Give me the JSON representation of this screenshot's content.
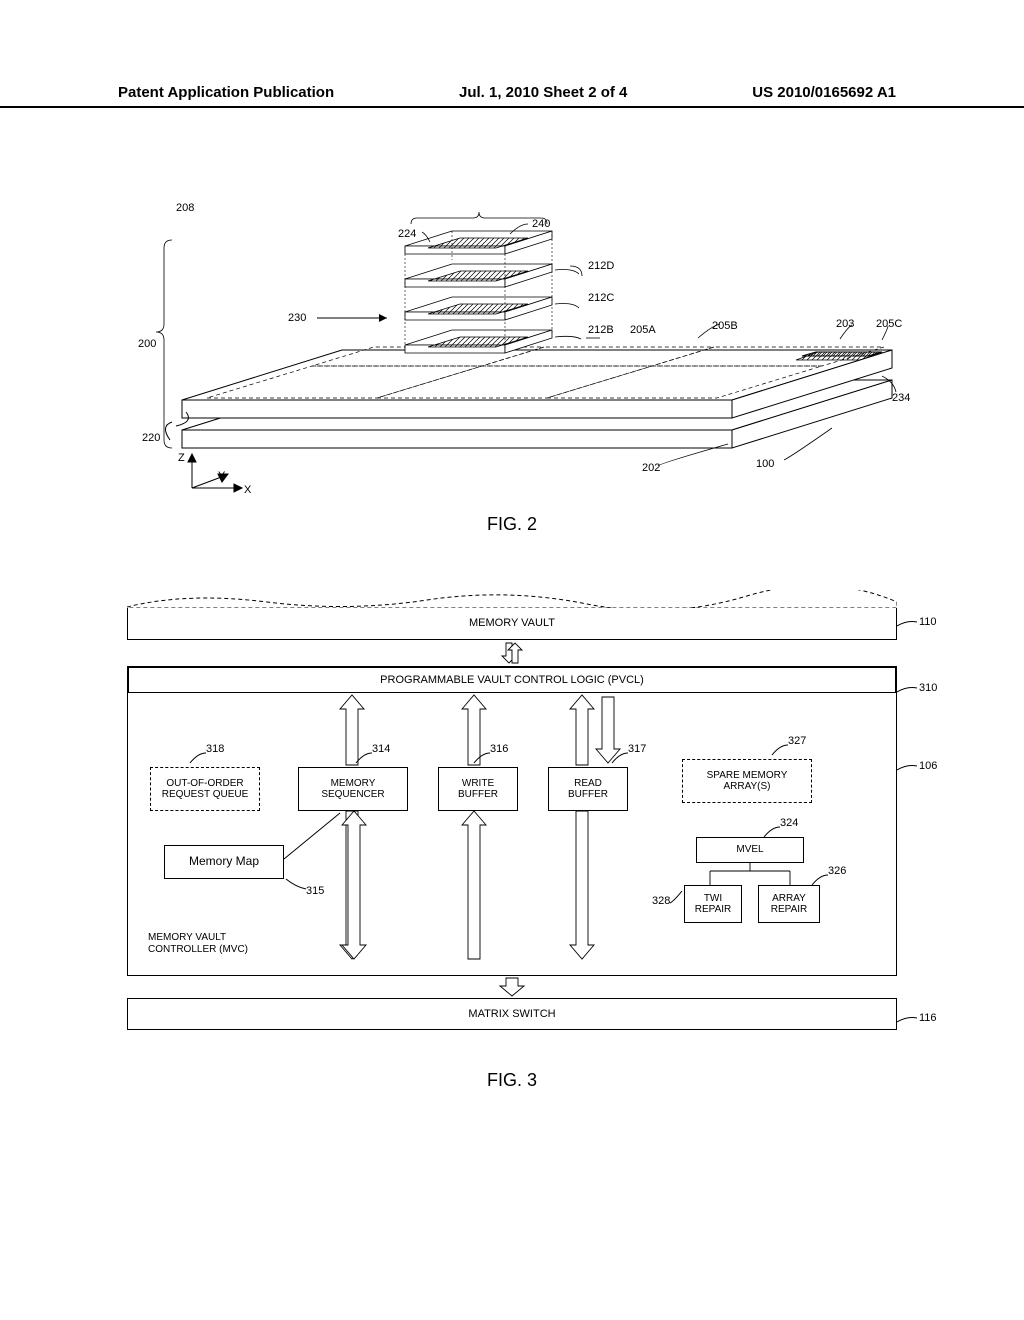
{
  "header": {
    "left": "Patent Application Publication",
    "center": "Jul. 1, 2010   Sheet 2 of 4",
    "right": "US 2010/0165692 A1"
  },
  "fig2": {
    "caption": "FIG. 2",
    "labels": {
      "l200": "200",
      "l220": "220",
      "l230": "230",
      "l208": "208",
      "l240": "240",
      "l224": "224",
      "l212D": "212D",
      "l212C": "212C",
      "l212B": "212B",
      "l205A": "205A",
      "l205B": "205B",
      "l203": "203",
      "l205C": "205C",
      "l234": "234",
      "l202": "202",
      "l100": "100",
      "axis_x": "X",
      "axis_y": "Y",
      "axis_z": "Z"
    }
  },
  "fig3": {
    "caption": "FIG. 3",
    "memory_vault": "MEMORY VAULT",
    "pvcl": "PROGRAMMABLE VAULT CONTROL LOGIC (PVCL)",
    "blocks": {
      "ooo_queue": "OUT-OF-ORDER\nREQUEST QUEUE",
      "mem_seq": "MEMORY\nSEQUENCER",
      "write_buf": "WRITE\nBUFFER",
      "read_buf": "READ\nBUFFER",
      "spare_mem": "SPARE MEMORY\nARRAY(S)",
      "mvel": "MVEL",
      "twi_repair": "TWI\nREPAIR",
      "array_repair": "ARRAY\nREPAIR",
      "memory_map": "Memory Map"
    },
    "mvc_title": "MEMORY VAULT\nCONTROLLER (MVC)",
    "matrix_switch": "MATRIX SWITCH",
    "refs": {
      "r110": "110",
      "r310": "310",
      "r318": "318",
      "r314": "314",
      "r316": "316",
      "r317": "317",
      "r327": "327",
      "r106": "106",
      "r324": "324",
      "r326": "326",
      "r328": "328",
      "r315": "315",
      "r116": "116"
    }
  }
}
